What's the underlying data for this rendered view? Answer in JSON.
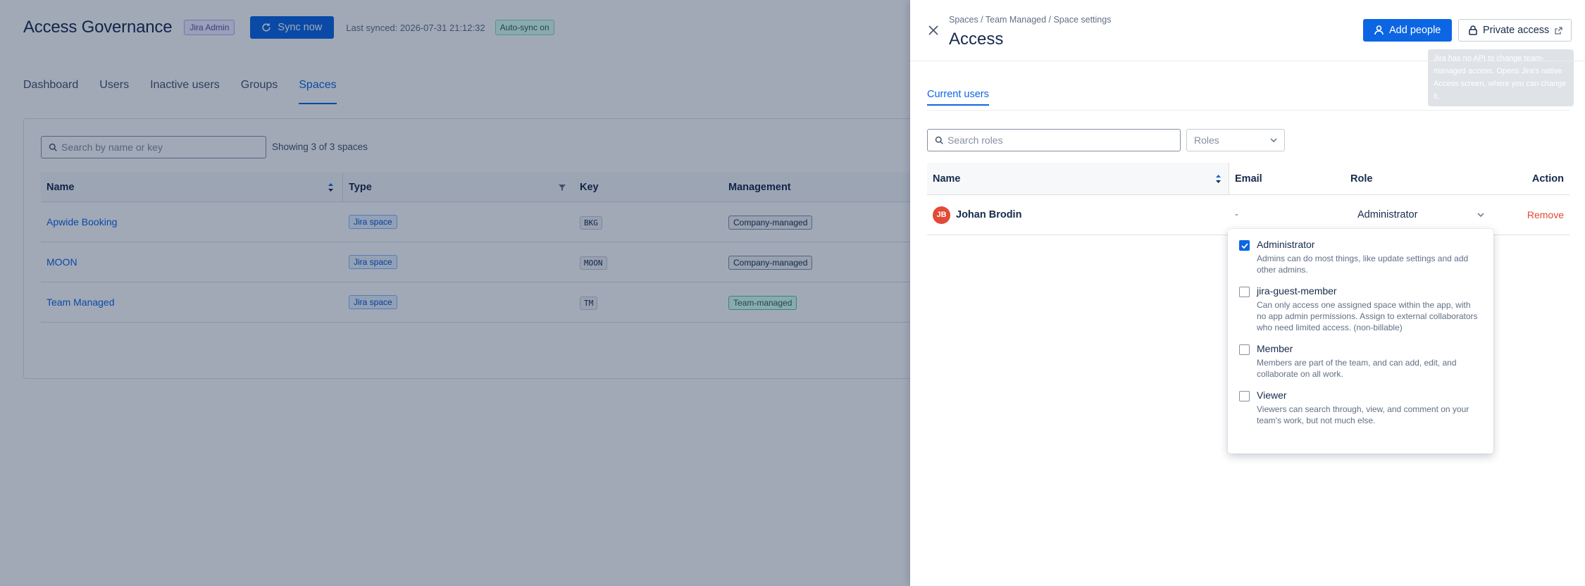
{
  "app": {
    "title": "Access Governance",
    "role_badge": "Jira Admin",
    "sync_button": "Sync now",
    "last_synced": "Last synced: 2026-07-31 21:12:32",
    "auto_sync": "Auto-sync on",
    "tabs": [
      "Dashboard",
      "Users",
      "Inactive users",
      "Groups",
      "Spaces"
    ],
    "active_tab": "Spaces",
    "search_placeholder": "Search by name or key",
    "showing": "Showing 3 of 3 spaces",
    "table": {
      "headers": [
        "Name",
        "Type",
        "Key",
        "Management"
      ],
      "rows": [
        {
          "name": "Apwide Booking",
          "type": "Jira space",
          "key": "BKG",
          "management": "Company-managed"
        },
        {
          "name": "MOON",
          "type": "Jira space",
          "key": "MOON",
          "management": "Company-managed"
        },
        {
          "name": "Team Managed",
          "type": "Jira space",
          "key": "TM",
          "management": "Team-managed"
        }
      ]
    }
  },
  "panel": {
    "breadcrumb": "Spaces / Team Managed / Space settings",
    "title": "Access",
    "add_people": "Add people",
    "private_access": "Private access",
    "tooltip": "Jira has no API to change team-managed access. Opens Jira's native Access screen, where you can change it.",
    "tab": "Current users",
    "search_placeholder": "Search roles",
    "roles_placeholder": "Roles",
    "table": {
      "headers": [
        "Name",
        "Email",
        "Role",
        "Action"
      ],
      "rows": [
        {
          "initials": "JB",
          "name": "Johan Brodin",
          "email": "-",
          "role": "Administrator",
          "action": "Remove"
        }
      ]
    },
    "role_options": [
      {
        "title": "Administrator",
        "desc": "Admins can do most things, like update settings and add other admins.",
        "checked": true
      },
      {
        "title": "jira-guest-member",
        "desc": "Can only access one assigned space within the app, with no app admin permissions. Assign to external collaborators who need limited access. (non-billable)",
        "checked": false
      },
      {
        "title": "Member",
        "desc": "Members are part of the team, and can add, edit, and collaborate on all work.",
        "checked": false
      },
      {
        "title": "Viewer",
        "desc": "Viewers can search through, view, and comment on your team's work, but not much else.",
        "checked": false
      }
    ]
  },
  "colors": {
    "accent": "#0c66e4",
    "danger": "#e34935",
    "overlay": "rgba(9, 30, 66, 0.38)"
  }
}
